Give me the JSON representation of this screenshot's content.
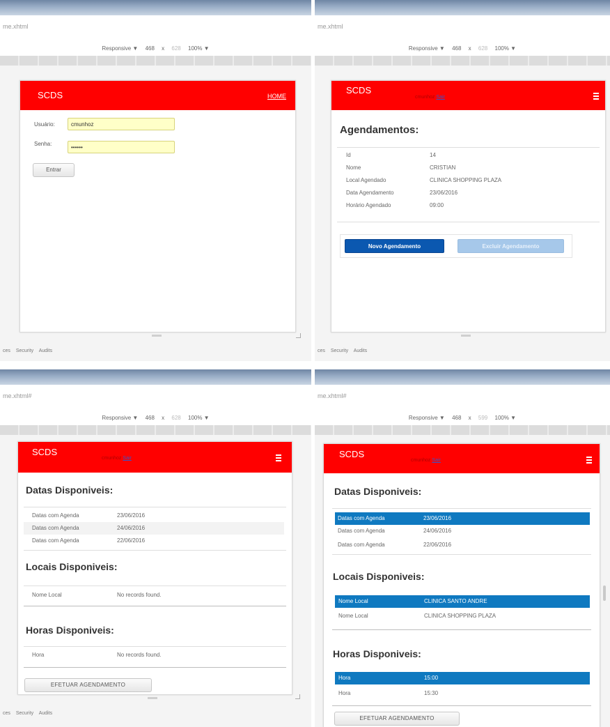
{
  "browser": {
    "url_1": "me.xhtml",
    "url_2": "me.xhtml",
    "url_3": "me.xhtml#",
    "url_4": "me.xhtml#",
    "device_mode": "Responsive ▼",
    "width_value": "468",
    "height_sep": "x",
    "height_value_1": "628",
    "height_value_2": "628",
    "height_value_3": "628",
    "height_value_4": "599",
    "zoom": "100% ▼",
    "devtools_tabs": [
      "ces",
      "Security",
      "Audits"
    ]
  },
  "app": {
    "brand": "SCDS",
    "home_link": "HOME",
    "user_name": "cmunhoz",
    "logout": "Sair"
  },
  "login": {
    "user_label": "Usuário:",
    "user_value": "cmunhoz",
    "password_label": "Senha:",
    "password_value": "••••••",
    "submit_label": "Entrar"
  },
  "agendamentos": {
    "title": "Agendamentos:",
    "fields": [
      {
        "label": "Id",
        "value": "14"
      },
      {
        "label": "Nome",
        "value": "CRISTIAN"
      },
      {
        "label": "Local Agendado",
        "value": "CLINICA SHOPPING PLAZA"
      },
      {
        "label": "Data Agendamento",
        "value": "23/06/2016"
      },
      {
        "label": "Horário Agendado",
        "value": "09:00"
      }
    ],
    "new_button": "Novo Agendamento",
    "delete_button": "Excluir Agendamento"
  },
  "disponiveis_empty": {
    "dates_title": "Datas Disponiveis:",
    "dates": [
      {
        "label": "Datas com Agenda",
        "value": "23/06/2016"
      },
      {
        "label": "Datas com Agenda",
        "value": "24/06/2016"
      },
      {
        "label": "Datas com Agenda",
        "value": "22/06/2016"
      }
    ],
    "locais_title": "Locais Disponiveis:",
    "locais_header": "Nome Local",
    "locais_empty": "No records found.",
    "horas_title": "Horas Disponiveis:",
    "horas_header": "Hora",
    "horas_empty": "No records found.",
    "submit_label": "EFETUAR AGENDAMENTO"
  },
  "disponiveis_selected": {
    "dates_title": "Datas Disponiveis:",
    "dates": [
      {
        "label": "Datas com Agenda",
        "value": "23/06/2016"
      },
      {
        "label": "Datas com Agenda",
        "value": "24/06/2016"
      },
      {
        "label": "Datas com Agenda",
        "value": "22/06/2016"
      }
    ],
    "locais_title": "Locais Disponiveis:",
    "locais": [
      {
        "label": "Nome Local",
        "value": "CLINICA SANTO ANDRE"
      },
      {
        "label": "Nome Local",
        "value": "CLINICA SHOPPING PLAZA"
      }
    ],
    "horas_title": "Horas Disponiveis:",
    "horas": [
      {
        "label": "Hora",
        "value": "15:00"
      },
      {
        "label": "Hora",
        "value": "15:30"
      }
    ],
    "submit_label": "EFETUAR AGENDAMENTO"
  },
  "colors": {
    "header_red": "#ff0000",
    "selection_blue": "#0f79c0",
    "primary_blue": "#0b58b0",
    "input_yellow": "#ffffc8"
  }
}
